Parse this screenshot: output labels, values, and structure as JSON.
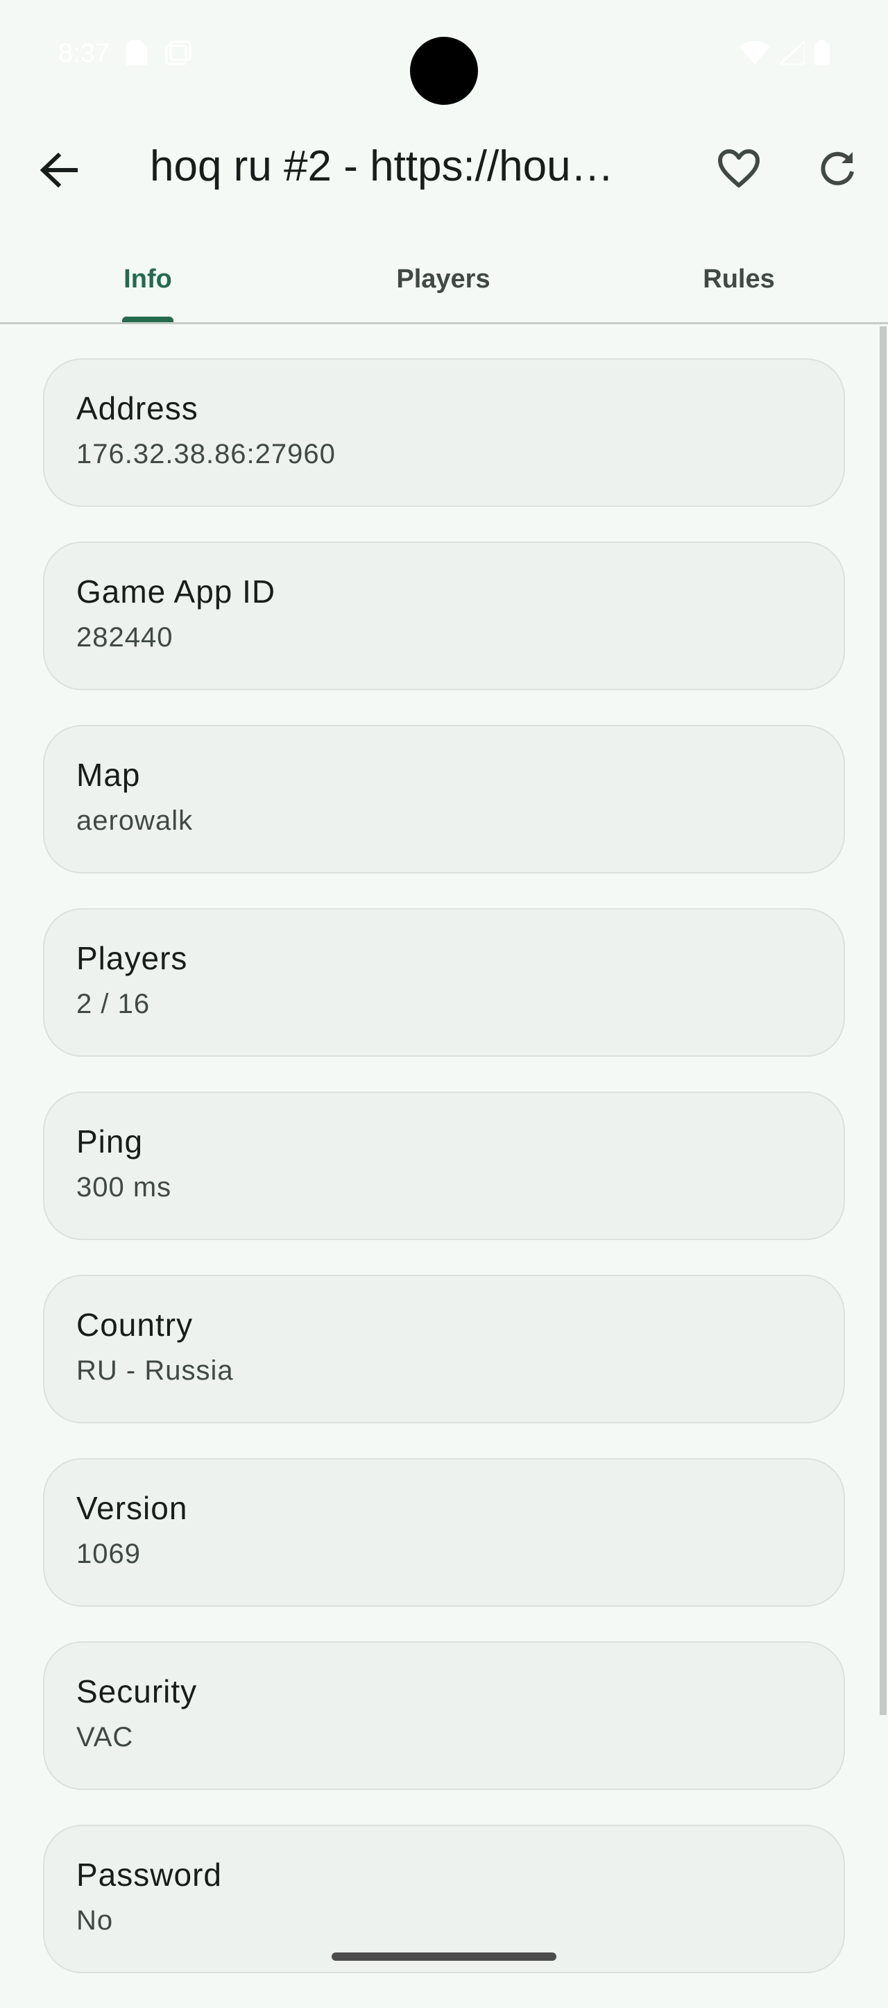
{
  "status_bar": {
    "time": "8:37"
  },
  "app_bar": {
    "title": "hoq ru #2 - https://hou…",
    "back_icon": "arrow-back-icon",
    "favorite_icon": "heart-outline-icon",
    "refresh_icon": "refresh-icon"
  },
  "tabs": [
    {
      "label": "Info",
      "active": true
    },
    {
      "label": "Players",
      "active": false
    },
    {
      "label": "Rules",
      "active": false
    }
  ],
  "info": [
    {
      "label": "Address",
      "value": "176.32.38.86:27960"
    },
    {
      "label": "Game App ID",
      "value": "282440"
    },
    {
      "label": "Map",
      "value": "aerowalk"
    },
    {
      "label": "Players",
      "value": "2 / 16"
    },
    {
      "label": "Ping",
      "value": "300 ms"
    },
    {
      "label": "Country",
      "value": "RU - Russia"
    },
    {
      "label": "Version",
      "value": "1069"
    },
    {
      "label": "Security",
      "value": "VAC"
    },
    {
      "label": "Password",
      "value": "No"
    }
  ],
  "colors": {
    "accent": "#256a4e",
    "background": "#f4f9f5",
    "card": "#edf2ee"
  }
}
